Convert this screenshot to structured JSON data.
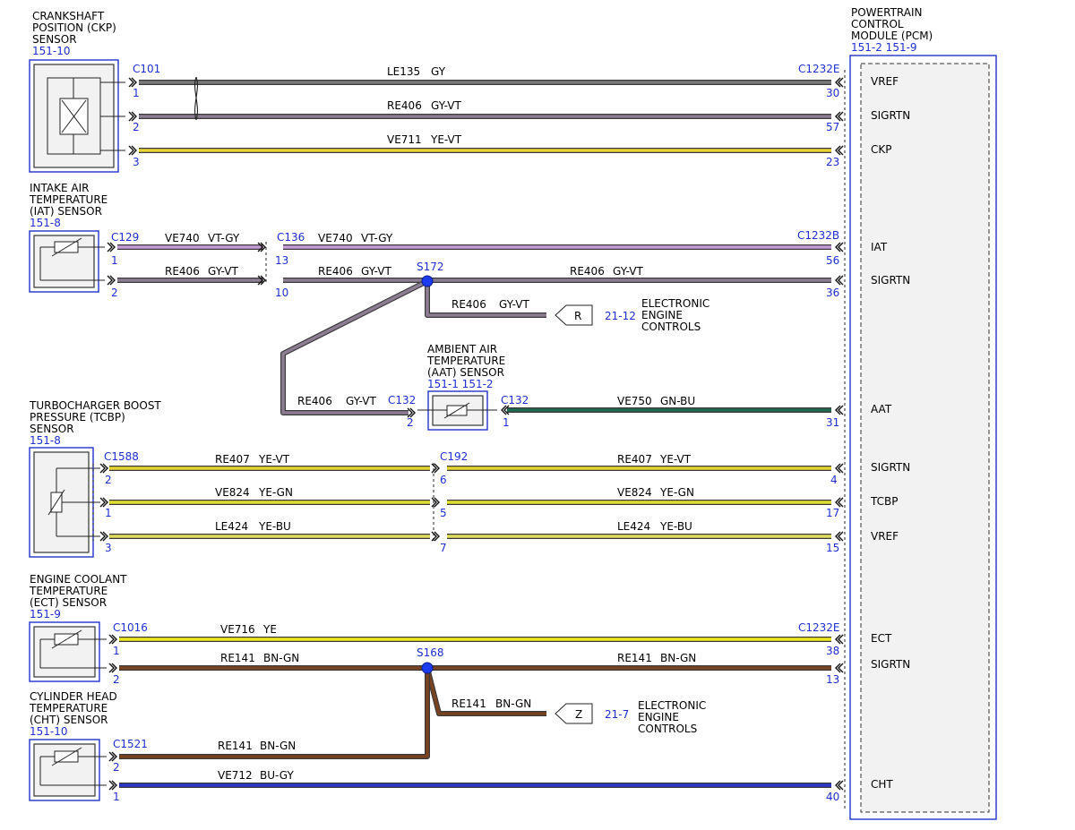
{
  "pcm": {
    "name": [
      "POWERTRAIN",
      "CONTROL",
      "MODULE (PCM)"
    ],
    "ref": "151-2  151-9",
    "pins": [
      "VREF",
      "SIGRTN",
      "CKP",
      "IAT",
      "SIGRTN",
      "AAT",
      "SIGRTN",
      "TCBP",
      "VREF",
      "ECT",
      "SIGRTN",
      "CHT"
    ]
  },
  "components": {
    "ckp": {
      "name": [
        "CRANKSHAFT",
        "POSITION (CKP)",
        "SENSOR"
      ],
      "ref": "151-10"
    },
    "iat": {
      "name": [
        "INTAKE AIR",
        "TEMPERATURE",
        "(IAT) SENSOR"
      ],
      "ref": "151-8"
    },
    "aat": {
      "name": [
        "AMBIENT AIR",
        "TEMPERATURE",
        "(AAT) SENSOR"
      ],
      "ref": "151-1  151-2"
    },
    "tcbp": {
      "name": [
        "TURBOCHARGER BOOST",
        "PRESSURE (TCBP)",
        "SENSOR"
      ],
      "ref": "151-8"
    },
    "ect": {
      "name": [
        "ENGINE COOLANT",
        "TEMPERATURE",
        "(ECT) SENSOR"
      ],
      "ref": "151-9"
    },
    "cht": {
      "name": [
        "CYLINDER HEAD",
        "TEMPERATURE",
        "(CHT) SENSOR"
      ],
      "ref": "151-10"
    }
  },
  "connectors": [
    "C101",
    "C1232E",
    "C129",
    "C136",
    "C1232B",
    "C132",
    "C132",
    "C1588",
    "C192",
    "C1016",
    "C1232E",
    "C1521"
  ],
  "splices": [
    "S172",
    "S168"
  ],
  "wires": [
    {
      "circuit": "LE135",
      "color": "GY"
    },
    {
      "circuit": "RE406",
      "color": "GY-VT"
    },
    {
      "circuit": "VE711",
      "color": "YE-VT"
    },
    {
      "circuit": "VE740",
      "color": "VT-GY"
    },
    {
      "circuit": "VE740",
      "color": "VT-GY"
    },
    {
      "circuit": "RE406",
      "color": "GY-VT"
    },
    {
      "circuit": "RE406",
      "color": "GY-VT"
    },
    {
      "circuit": "RE406",
      "color": "GY-VT"
    },
    {
      "circuit": "RE406",
      "color": "GY-VT"
    },
    {
      "circuit": "RE406",
      "color": "GY-VT"
    },
    {
      "circuit": "VE750",
      "color": "GN-BU"
    },
    {
      "circuit": "RE407",
      "color": "YE-VT"
    },
    {
      "circuit": "RE407",
      "color": "YE-VT"
    },
    {
      "circuit": "VE824",
      "color": "YE-GN"
    },
    {
      "circuit": "VE824",
      "color": "YE-GN"
    },
    {
      "circuit": "LE424",
      "color": "YE-BU"
    },
    {
      "circuit": "LE424",
      "color": "YE-BU"
    },
    {
      "circuit": "VE716",
      "color": "YE"
    },
    {
      "circuit": "RE141",
      "color": "BN-GN"
    },
    {
      "circuit": "RE141",
      "color": "BN-GN"
    },
    {
      "circuit": "RE141",
      "color": "BN-GN"
    },
    {
      "circuit": "RE141",
      "color": "BN-GN"
    },
    {
      "circuit": "VE712",
      "color": "BU-GY"
    }
  ],
  "pin_numbers": [
    "1",
    "30",
    "2",
    "57",
    "3",
    "23",
    "1",
    "13",
    "56",
    "2",
    "10",
    "36",
    "2",
    "1",
    "31",
    "2",
    "6",
    "4",
    "1",
    "5",
    "17",
    "3",
    "7",
    "15",
    "1",
    "38",
    "2",
    "13",
    "2",
    "1",
    "40"
  ],
  "references": [
    {
      "tag": "R",
      "page": "21-12",
      "name": [
        "ELECTRONIC",
        "ENGINE",
        "CONTROLS"
      ]
    },
    {
      "tag": "Z",
      "page": "21-7",
      "name": [
        "ELECTRONIC",
        "ENGINE",
        "CONTROLS"
      ]
    }
  ],
  "wire_colors": {
    "GY": "#7a7a7a",
    "GY-VT": "#8c7d92",
    "YE-VT": "#e8d430",
    "VT-GY": "#c59ad6",
    "GN-BU": "#1f6a50",
    "YE-GN": "#dfe030",
    "YE-BU": "#e0dc60",
    "YE": "#f0e81e",
    "BN-GN": "#7a4320",
    "BU-GY": "#2a36c8",
    "splice": "#1c3cf0",
    "blue_text": "#1f2fd0"
  }
}
